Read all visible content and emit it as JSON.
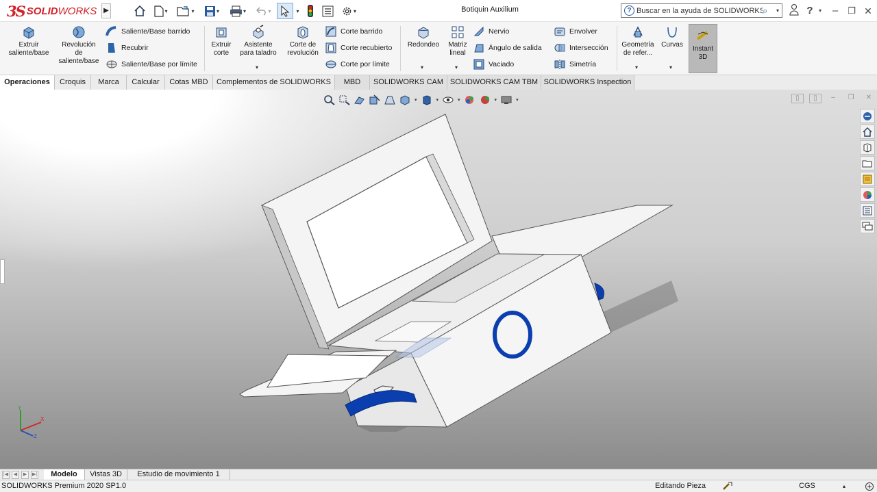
{
  "app": {
    "logo_ds": "3S",
    "logo_text_bold": "SOLID",
    "logo_text_light": "WORKS",
    "document_title": "Botiquin Auxilium",
    "help_search_placeholder": "Buscar en la ayuda de SOLIDWORKS",
    "brand_color": "#d1232a"
  },
  "quick_access": [
    {
      "icon": "home-icon"
    },
    {
      "icon": "new-document-icon"
    },
    {
      "icon": "open-folder-icon"
    },
    {
      "icon": "save-icon"
    },
    {
      "icon": "print-icon"
    },
    {
      "icon": "undo-icon"
    },
    {
      "icon": "select-pointer-icon"
    },
    {
      "icon": "rebuild-traffic-light-icon"
    },
    {
      "icon": "file-properties-icon"
    },
    {
      "icon": "options-gear-icon"
    }
  ],
  "ribbon": {
    "extruir_saliente": [
      "Extruir",
      "saliente/base"
    ],
    "revolucion_saliente": [
      "Revolución",
      "de",
      "saliente/base"
    ],
    "saliente_barrido": "Saliente/Base barrido",
    "recubrir": "Recubrir",
    "saliente_limite": "Saliente/Base por límite",
    "extruir_corte": [
      "Extruir",
      "corte"
    ],
    "asistente_taladro": [
      "Asistente",
      "para taladro"
    ],
    "corte_revolucion": [
      "Corte de",
      "revolución"
    ],
    "corte_barrido": "Corte barrido",
    "corte_recubierto": "Corte recubierto",
    "corte_limite": "Corte por límite",
    "redondeo": "Redondeo",
    "matriz_lineal": [
      "Matriz",
      "lineal"
    ],
    "nervio": "Nervio",
    "angulo_salida": "Ángulo de salida",
    "vaciado": "Vaciado",
    "envolver": "Envolver",
    "interseccion": "Intersección",
    "simetria": "Simetría",
    "geometria_ref": [
      "Geometría",
      "de refer..."
    ],
    "curvas": "Curvas",
    "instant3d": [
      "Instant",
      "3D"
    ]
  },
  "tabs": [
    "Operaciones",
    "Croquis",
    "Marca",
    "Calcular",
    "Cotas MBD",
    "Complementos de SOLIDWORKS",
    "MBD",
    "SOLIDWORKS CAM",
    "SOLIDWORKS CAM TBM",
    "SOLIDWORKS Inspection"
  ],
  "active_tab": "Operaciones",
  "bottom_tabs": [
    "Modelo",
    "Vistas 3D",
    "Estudio de movimiento 1"
  ],
  "status": {
    "product": "SOLIDWORKS Premium 2020 SP1.0",
    "mode": "Editando Pieza",
    "units": "CGS"
  },
  "triad": {
    "x": "X",
    "y": "Y",
    "z": "Z"
  },
  "colors": {
    "part_white": "#f4f4f4",
    "feature_blue": "#0b3fb0",
    "instant3d_active": "#b9b9b9"
  }
}
